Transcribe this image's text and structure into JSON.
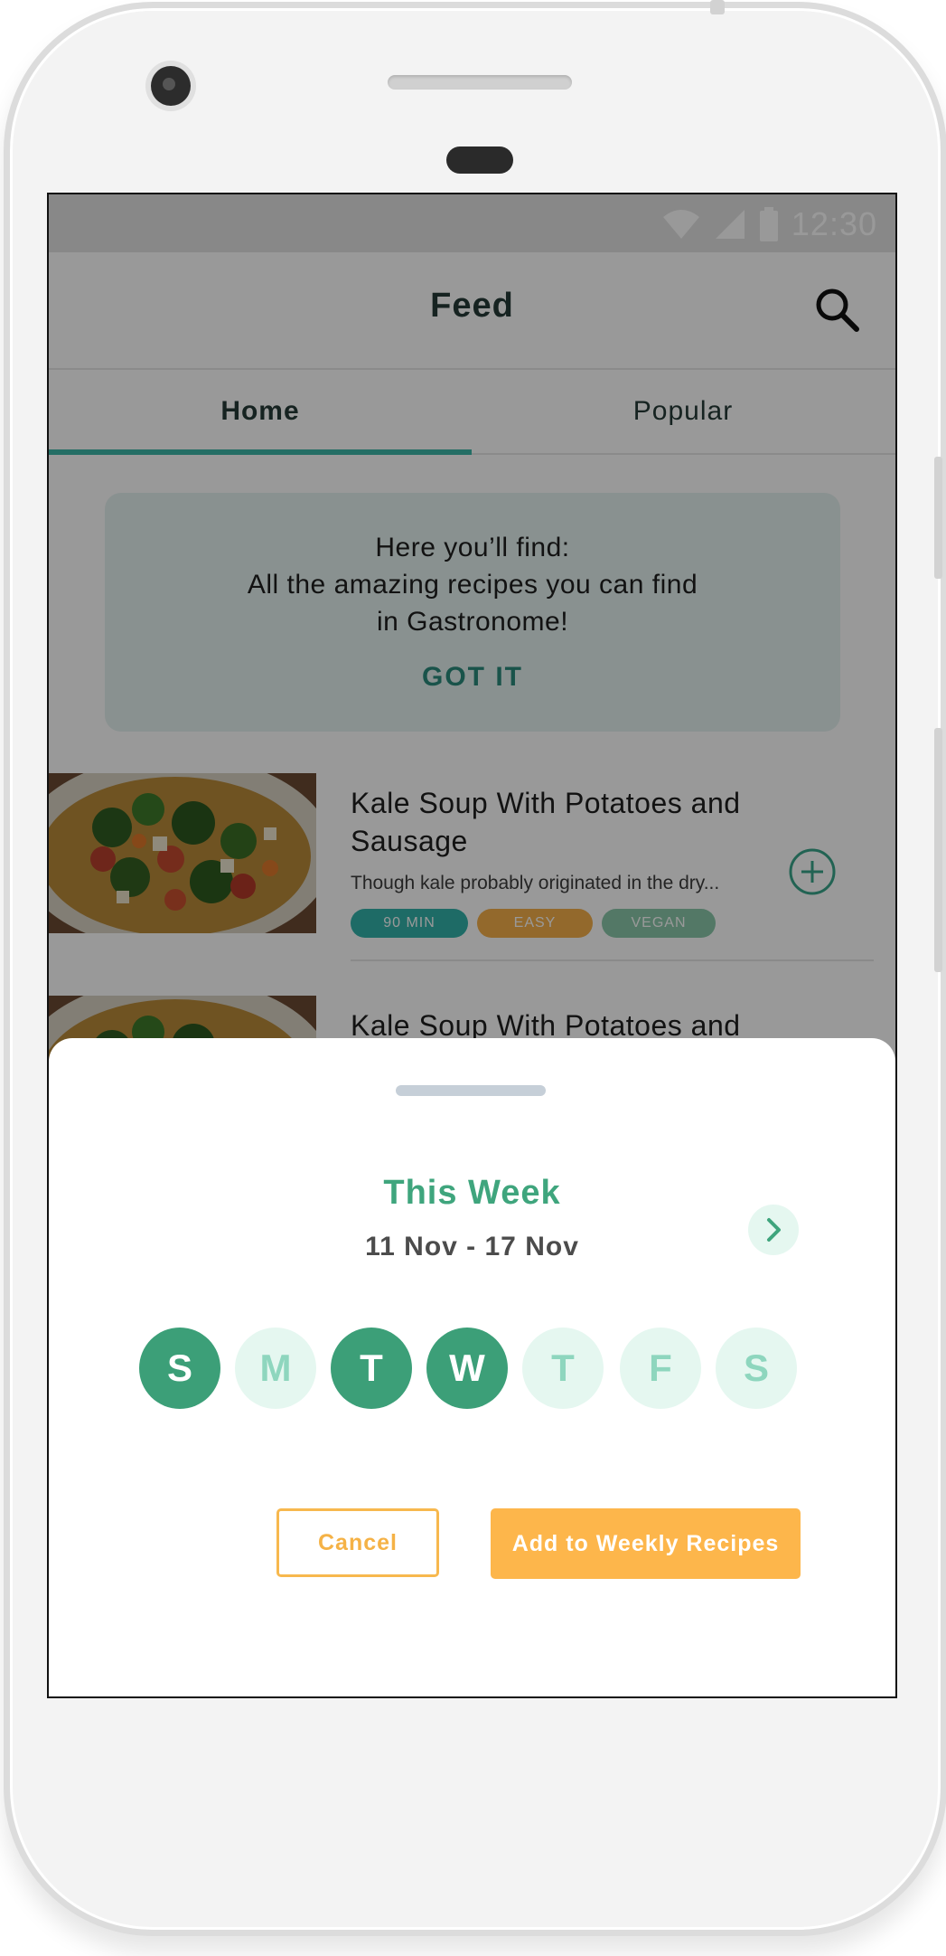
{
  "status_bar": {
    "time": "12:30",
    "icons": [
      "wifi-icon",
      "signal-icon",
      "battery-icon"
    ]
  },
  "app_bar": {
    "title": "Feed",
    "search_icon": "search-icon"
  },
  "tabs": [
    {
      "label": "Home",
      "selected": true
    },
    {
      "label": "Popular",
      "selected": false
    }
  ],
  "info_card": {
    "lines": [
      "Here you’ll find:",
      "All the amazing recipes you can find",
      "in Gastronome!"
    ],
    "action": "GOT IT"
  },
  "recipes": [
    {
      "title_line1": "Kale Soup With Potatoes and",
      "title_line2": "Sausage",
      "description": "Though kale probably originated in the dry...",
      "tags": [
        "90 MIN",
        "EASY",
        "VEGAN"
      ]
    },
    {
      "title_line1": "Kale Soup With Potatoes and",
      "title_line2": "",
      "description": "",
      "tags": []
    }
  ],
  "sheet": {
    "title": "This Week",
    "date_range": "11 Nov - 17 Nov",
    "next_icon": "chevron-right-icon",
    "days": [
      {
        "letter": "S",
        "selected": true
      },
      {
        "letter": "M",
        "selected": false
      },
      {
        "letter": "T",
        "selected": true
      },
      {
        "letter": "W",
        "selected": true
      },
      {
        "letter": "T",
        "selected": false
      },
      {
        "letter": "F",
        "selected": false
      },
      {
        "letter": "S",
        "selected": false
      }
    ],
    "cancel_label": "Cancel",
    "confirm_label": "Add to Weekly Recipes"
  },
  "colors": {
    "accent_teal": "#3db8a8",
    "selected_day": "#3c9f78",
    "unselected_day": "#e5f7f0",
    "primary_orange": "#fdb64b"
  }
}
